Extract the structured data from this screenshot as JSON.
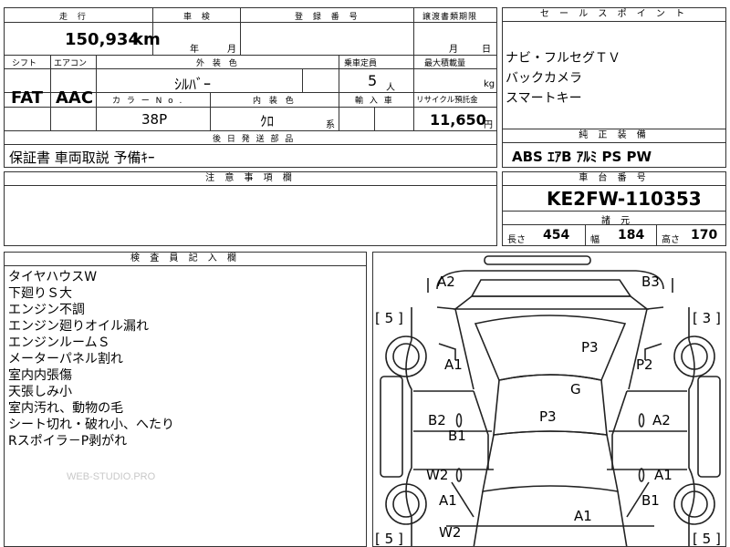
{
  "top_table": {
    "headers": {
      "mileage": "走 行",
      "inspection": "車 検",
      "registration": "登 録 番 号",
      "transfer_deadline": "譲渡書類期限",
      "shift": "シフト",
      "aircon": "エアコン",
      "exterior_color": "外 装 色",
      "capacity": "乗車定員",
      "max_load": "最大積載量",
      "color_no": "カ ラ ー N o .",
      "interior_color": "内 装 色",
      "import": "輸 入 車",
      "recycle": "リサイクル預託金",
      "shipping_parts": "後 日 発 送 部 品"
    },
    "mileage_value": "150,934",
    "mileage_unit": "km",
    "inspection_year_unit": "年",
    "inspection_month_unit": "月",
    "transfer_month_unit": "月",
    "transfer_day_unit": "日",
    "shift_value": "FAT",
    "aircon_value": "AAC",
    "exterior_color_value": "ｼﾙﾊﾞｰ",
    "capacity_value": "5",
    "capacity_unit": "人",
    "max_load_unit": "kg",
    "color_no_value": "38P",
    "interior_color_value": "ｸﾛ",
    "interior_color_suffix": "系",
    "recycle_value": "11,650",
    "recycle_unit": "円",
    "shipping_parts_value": "保証書 車両取説 予備ｷｰ"
  },
  "notes": {
    "header": "注 意 事 項 欄"
  },
  "sales_points": {
    "header": "セ ー ル ス ポ イ ン ト",
    "items": [
      "ナビ・フルセグＴＶ",
      "バックカメラ",
      "スマートキー"
    ]
  },
  "equipment": {
    "header": "純 正 装 備",
    "value": "ABS ｴｱB ｱﾙﾐ PS PW"
  },
  "chassis": {
    "header": "車 台 番 号",
    "value": "KE2FW-110353"
  },
  "specs": {
    "header": "諸 元",
    "length_label": "長さ",
    "length_value": "454",
    "width_label": "幅",
    "width_value": "184",
    "height_label": "高さ",
    "height_value": "170"
  },
  "inspector": {
    "header": "検 査 員 記 入 欄",
    "items": [
      "タイヤハウスW",
      "下廻りＳ大",
      "エンジン不調",
      "エンジン廻りオイル漏れ",
      "エンジンルームＳ",
      "メーターパネル割れ",
      "室内内張傷",
      "天張しみ小",
      "室内汚れ、動物の毛",
      "シート切れ・破れ小、へたり",
      "Rスポイラ－P剥がれ"
    ],
    "watermark": "WEB-STUDIO.PRO"
  },
  "diagram": {
    "marks": [
      "A2",
      "B3",
      "P3",
      "A1",
      "P2",
      "G",
      "P3",
      "B2",
      "A2",
      "B1",
      "W2",
      "A1",
      "A1",
      "B1",
      "A1",
      "W2"
    ],
    "tires": [
      "5",
      "3",
      "5",
      "5"
    ]
  },
  "colors": {
    "border": "#333333",
    "background": "#ffffff"
  }
}
